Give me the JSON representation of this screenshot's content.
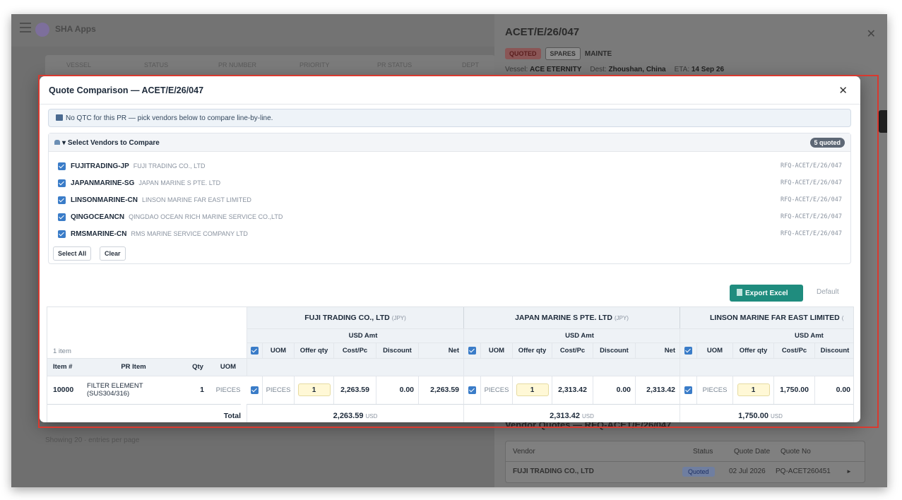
{
  "background": {
    "app_brand": "SHA Apps",
    "filter_labels": [
      "VESSEL",
      "STATUS",
      "PR NUMBER",
      "PRIORITY",
      "PR STATUS",
      "DEPT"
    ],
    "footer_text": "Showing  20  ·  entries per page"
  },
  "drawer": {
    "title": "ACET/E/26/047",
    "badges": {
      "quoted": "QUOTED",
      "spares": "SPARES",
      "category": "MAINTE"
    },
    "vessel_label": "Vessel:",
    "vessel": "ACE ETERNITY",
    "dest_label": "Dest:",
    "dest": "Zhoushan, China",
    "eta_label": "ETA:",
    "eta": "14 Sep 26",
    "vendor_quotes_title": "Vendor Quotes — RFQ-ACET/E/26/047",
    "vq_headers": {
      "vendor": "Vendor",
      "status": "Status",
      "date": "Quote Date",
      "no": "Quote No"
    },
    "vq_row": {
      "vendor": "FUJI TRADING CO., LTD",
      "status": "Quoted",
      "date": "02 Jul 2026",
      "no": "PQ-ACET260451"
    }
  },
  "modal": {
    "title": "Quote Comparison — ACET/E/26/047",
    "info": "No QTC for this PR — pick vendors below to compare line-by-line.",
    "select_title": "Select Vendors to Compare",
    "quoted_count": "5 quoted",
    "vendors": [
      {
        "code": "FUJITRADING-JP",
        "name": "FUJI TRADING CO., LTD",
        "rfq": "RFQ-ACET/E/26/047"
      },
      {
        "code": "JAPANMARINE-SG",
        "name": "JAPAN MARINE S PTE. LTD",
        "rfq": "RFQ-ACET/E/26/047"
      },
      {
        "code": "LINSONMARINE-CN",
        "name": "LINSON MARINE FAR EAST LIMITED",
        "rfq": "RFQ-ACET/E/26/047"
      },
      {
        "code": "QINGOCEANCN",
        "name": "QINGDAO OCEAN RICH MARINE SERVICE CO.,LTD",
        "rfq": "RFQ-ACET/E/26/047"
      },
      {
        "code": "RMSMARINE-CN",
        "name": "RMS MARINE SERVICE COMPANY LTD",
        "rfq": "RFQ-ACET/E/26/047"
      }
    ],
    "select_all": "Select All",
    "clear": "Clear",
    "export": "Export Excel",
    "default": "Default"
  },
  "table": {
    "item_count": "1 item",
    "left_headers": {
      "item": "Item #",
      "pr_item": "PR Item",
      "qty": "Qty",
      "uom": "UOM"
    },
    "sub_headers": {
      "uom": "UOM",
      "offer_qty": "Offer qty",
      "cost": "Cost/Pc",
      "discount": "Discount",
      "net": "Net"
    },
    "usd_amt": "USD Amt",
    "row": {
      "item": "10000",
      "pr_item_l1": "FILTER ELEMENT",
      "pr_item_l2": "(SUS304/316)",
      "qty": "1",
      "uom": "PIECES"
    },
    "total_label": "Total",
    "vendors": [
      {
        "name": "FUJI TRADING CO., LTD",
        "currency": "(JPY)",
        "uom": "PIECES",
        "offer_qty": "1",
        "cost": "2,263.59",
        "discount": "0.00",
        "net": "2,263.59",
        "total": "2,263.59",
        "total_cur": "USD"
      },
      {
        "name": "JAPAN MARINE S PTE. LTD",
        "currency": "(JPY)",
        "uom": "PIECES",
        "offer_qty": "1",
        "cost": "2,313.42",
        "discount": "0.00",
        "net": "2,313.42",
        "total": "2,313.42",
        "total_cur": "USD"
      },
      {
        "name": "LINSON MARINE FAR EAST LIMITED",
        "currency": "(",
        "uom": "PIECES",
        "offer_qty": "1",
        "cost": "1,750.00",
        "discount": "0.00",
        "net": "",
        "total": "1,750.00",
        "total_cur": "USD"
      }
    ]
  }
}
